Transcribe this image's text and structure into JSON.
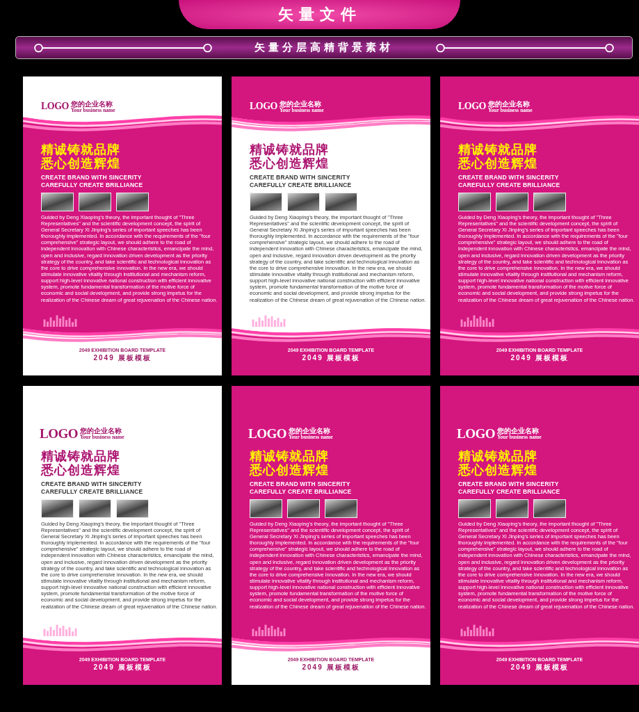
{
  "header": {
    "title": "矢量文件",
    "subtitle": "矢量分层高精背景素材"
  },
  "posters": [
    {
      "top_pink": false,
      "body_pink": true,
      "bottom_pink": false,
      "top_wave": true,
      "logo": "LOGO",
      "company": "您的企业名称",
      "company_en": "Your business name",
      "headline": [
        "精诚铸就品牌",
        "悉心创造辉煌"
      ],
      "english": [
        "CREATE BRAND WITH SINCERITY",
        "CAREFULLY CREATE BRILLIANCE"
      ],
      "paragraph": "Guided by Deng Xiaoping's theory, the important thought of \"Three Representatives\" and the scientific development concept, the spirit of General Secretary Xi Jinping's series of important speeches has been thoroughly implemented. In accordance with the requirements of the \"four comprehensive\" strategic layout, we should adhere to the road of independent innovation with Chinese characteristics, emancipate the mind, open and inclusive, regard innovation driven development as the priority strategy of the country, and take scientific and technological innovation as the core to drive comprehensive innovation. In the new era, we should stimulate innovative vitality through institutional and mechanism reform, support high-level innovative national construction with efficient innovative system, promote fundamental transformation of the motive force of economic and social development, and provide strong impetus for the realization of the Chinese dream of great rejuvenation of the Chinese nation.",
      "footer_en": "2049 EXHIBITION BOARD TEMPLATE",
      "footer_cn": "2049 展板模板"
    },
    {
      "top_pink": true,
      "body_pink": false,
      "bottom_pink": true,
      "top_wave": true,
      "logo": "LOGO",
      "company": "您的企业名称",
      "company_en": "Your business name",
      "headline": [
        "精诚铸就品牌",
        "悉心创造辉煌"
      ],
      "english": [
        "CREATE BRAND WITH SINCERITY",
        "CAREFULLY CREATE BRILLIANCE"
      ],
      "paragraph": "Guided by Deng Xiaoping's theory, the important thought of \"Three Representatives\" and the scientific development concept, the spirit of General Secretary Xi Jinping's series of important speeches has been thoroughly implemented. In accordance with the requirements of the \"four comprehensive\" strategic layout, we should adhere to the road of independent innovation with Chinese characteristics, emancipate the mind, open and inclusive, regard innovation driven development as the priority strategy of the country, and take scientific and technological innovation as the core to drive comprehensive innovation. In the new era, we should stimulate innovative vitality through institutional and mechanism reform, support high-level innovative national construction with efficient innovative system, promote fundamental transformation of the motive force of economic and social development, and provide strong impetus for the realization of the Chinese dream of great rejuvenation of the Chinese nation.",
      "footer_en": "2049 EXHIBITION BOARD TEMPLATE",
      "footer_cn": "2049 展板模板"
    },
    {
      "top_pink": true,
      "body_pink": true,
      "bottom_pink": true,
      "top_wave": true,
      "logo": "LOGO",
      "company": "您的企业名称",
      "company_en": "Your business name",
      "headline": [
        "精诚铸就品牌",
        "悉心创造辉煌"
      ],
      "english": [
        "CREATE BRAND WITH SINCERITY",
        "CAREFULLY CREATE BRILLIANCE"
      ],
      "paragraph": "Guided by Deng Xiaoping's theory, the important thought of \"Three Representatives\" and the scientific development concept, the spirit of General Secretary Xi Jinping's series of important speeches has been thoroughly implemented. In accordance with the requirements of the \"four comprehensive\" strategic layout, we should adhere to the road of independent innovation with Chinese characteristics, emancipate the mind, open and inclusive, regard innovation driven development as the priority strategy of the country, and take scientific and technological innovation as the core to drive comprehensive innovation. In the new era, we should stimulate innovative vitality through institutional and mechanism reform, support high-level innovative national construction with efficient innovative system, promote fundamental transformation of the motive force of economic and social development, and provide strong impetus for the realization of the Chinese dream of great rejuvenation of the Chinese nation.",
      "footer_en": "2049 EXHIBITION BOARD TEMPLATE",
      "footer_cn": "2049 展板模板"
    },
    {
      "top_pink": false,
      "body_pink": false,
      "bottom_pink": true,
      "top_wave": false,
      "logo": "LOGO",
      "company": "您的企业名称",
      "company_en": "Your business name",
      "headline": [
        "精诚铸就品牌",
        "悉心创造辉煌"
      ],
      "english": [
        "CREATE BRAND WITH SINCERITY",
        "CAREFULLY CREATE BRILLIANCE"
      ],
      "paragraph": "Guided by Deng Xiaoping's theory, the important thought of \"Three Representatives\" and the scientific development concept, the spirit of General Secretary Xi Jinping's series of important speeches has been thoroughly implemented. In accordance with the requirements of the \"four comprehensive\" strategic layout, we should adhere to the road of independent innovation with Chinese characteristics, emancipate the mind, open and inclusive, regard innovation driven development as the priority strategy of the country, and take scientific and technological innovation as the core to drive comprehensive innovation. In the new era, we should stimulate innovative vitality through institutional and mechanism reform, support high-level innovative national construction with efficient innovative system, promote fundamental transformation of the motive force of economic and social development, and provide strong impetus for the realization of the Chinese dream of great rejuvenation of the Chinese nation.",
      "footer_en": "2049 EXHIBITION BOARD TEMPLATE",
      "footer_cn": "2049 展板模板"
    },
    {
      "top_pink": true,
      "body_pink": true,
      "bottom_pink": false,
      "top_wave": false,
      "logo": "LOGO",
      "company": "您的企业名称",
      "company_en": "Your business name",
      "headline": [
        "精诚铸就品牌",
        "悉心创造辉煌"
      ],
      "english": [
        "CREATE BRAND WITH SINCERITY",
        "CAREFULLY CREATE BRILLIANCE"
      ],
      "paragraph": "Guided by Deng Xiaoping's theory, the important thought of \"Three Representatives\" and the scientific development concept, the spirit of General Secretary Xi Jinping's series of important speeches has been thoroughly implemented. In accordance with the requirements of the \"four comprehensive\" strategic layout, we should adhere to the road of independent innovation with Chinese characteristics, emancipate the mind, open and inclusive, regard innovation driven development as the priority strategy of the country, and take scientific and technological innovation as the core to drive comprehensive innovation. In the new era, we should stimulate innovative vitality through institutional and mechanism reform, support high-level innovative national construction with efficient innovative system, promote fundamental transformation of the motive force of economic and social development, and provide strong impetus for the realization of the Chinese dream of great rejuvenation of the Chinese nation.",
      "footer_en": "2049 EXHIBITION BOARD TEMPLATE",
      "footer_cn": "2049 展板模板"
    },
    {
      "top_pink": true,
      "body_pink": true,
      "bottom_pink": true,
      "top_wave": false,
      "logo": "LOGO",
      "company": "您的企业名称",
      "company_en": "Your business name",
      "headline": [
        "精诚铸就品牌",
        "悉心创造辉煌"
      ],
      "english": [
        "CREATE BRAND WITH SINCERITY",
        "CAREFULLY CREATE BRILLIANCE"
      ],
      "paragraph": "Guided by Deng Xiaoping's theory, the important thought of \"Three Representatives\" and the scientific development concept, the spirit of General Secretary Xi Jinping's series of important speeches has been thoroughly implemented. In accordance with the requirements of the \"four comprehensive\" strategic layout, we should adhere to the road of independent innovation with Chinese characteristics, emancipate the mind, open and inclusive, regard innovation driven development as the priority strategy of the country, and take scientific and technological innovation as the core to drive comprehensive innovation. In the new era, we should stimulate innovative vitality through institutional and mechanism reform, support high-level innovative national construction with efficient innovative system, promote fundamental transformation of the motive force of economic and social development, and provide strong impetus for the realization of the Chinese dream of great rejuvenation of the Chinese nation.",
      "footer_en": "2049 EXHIBITION BOARD TEMPLATE",
      "footer_cn": "2049 展板模板"
    }
  ]
}
